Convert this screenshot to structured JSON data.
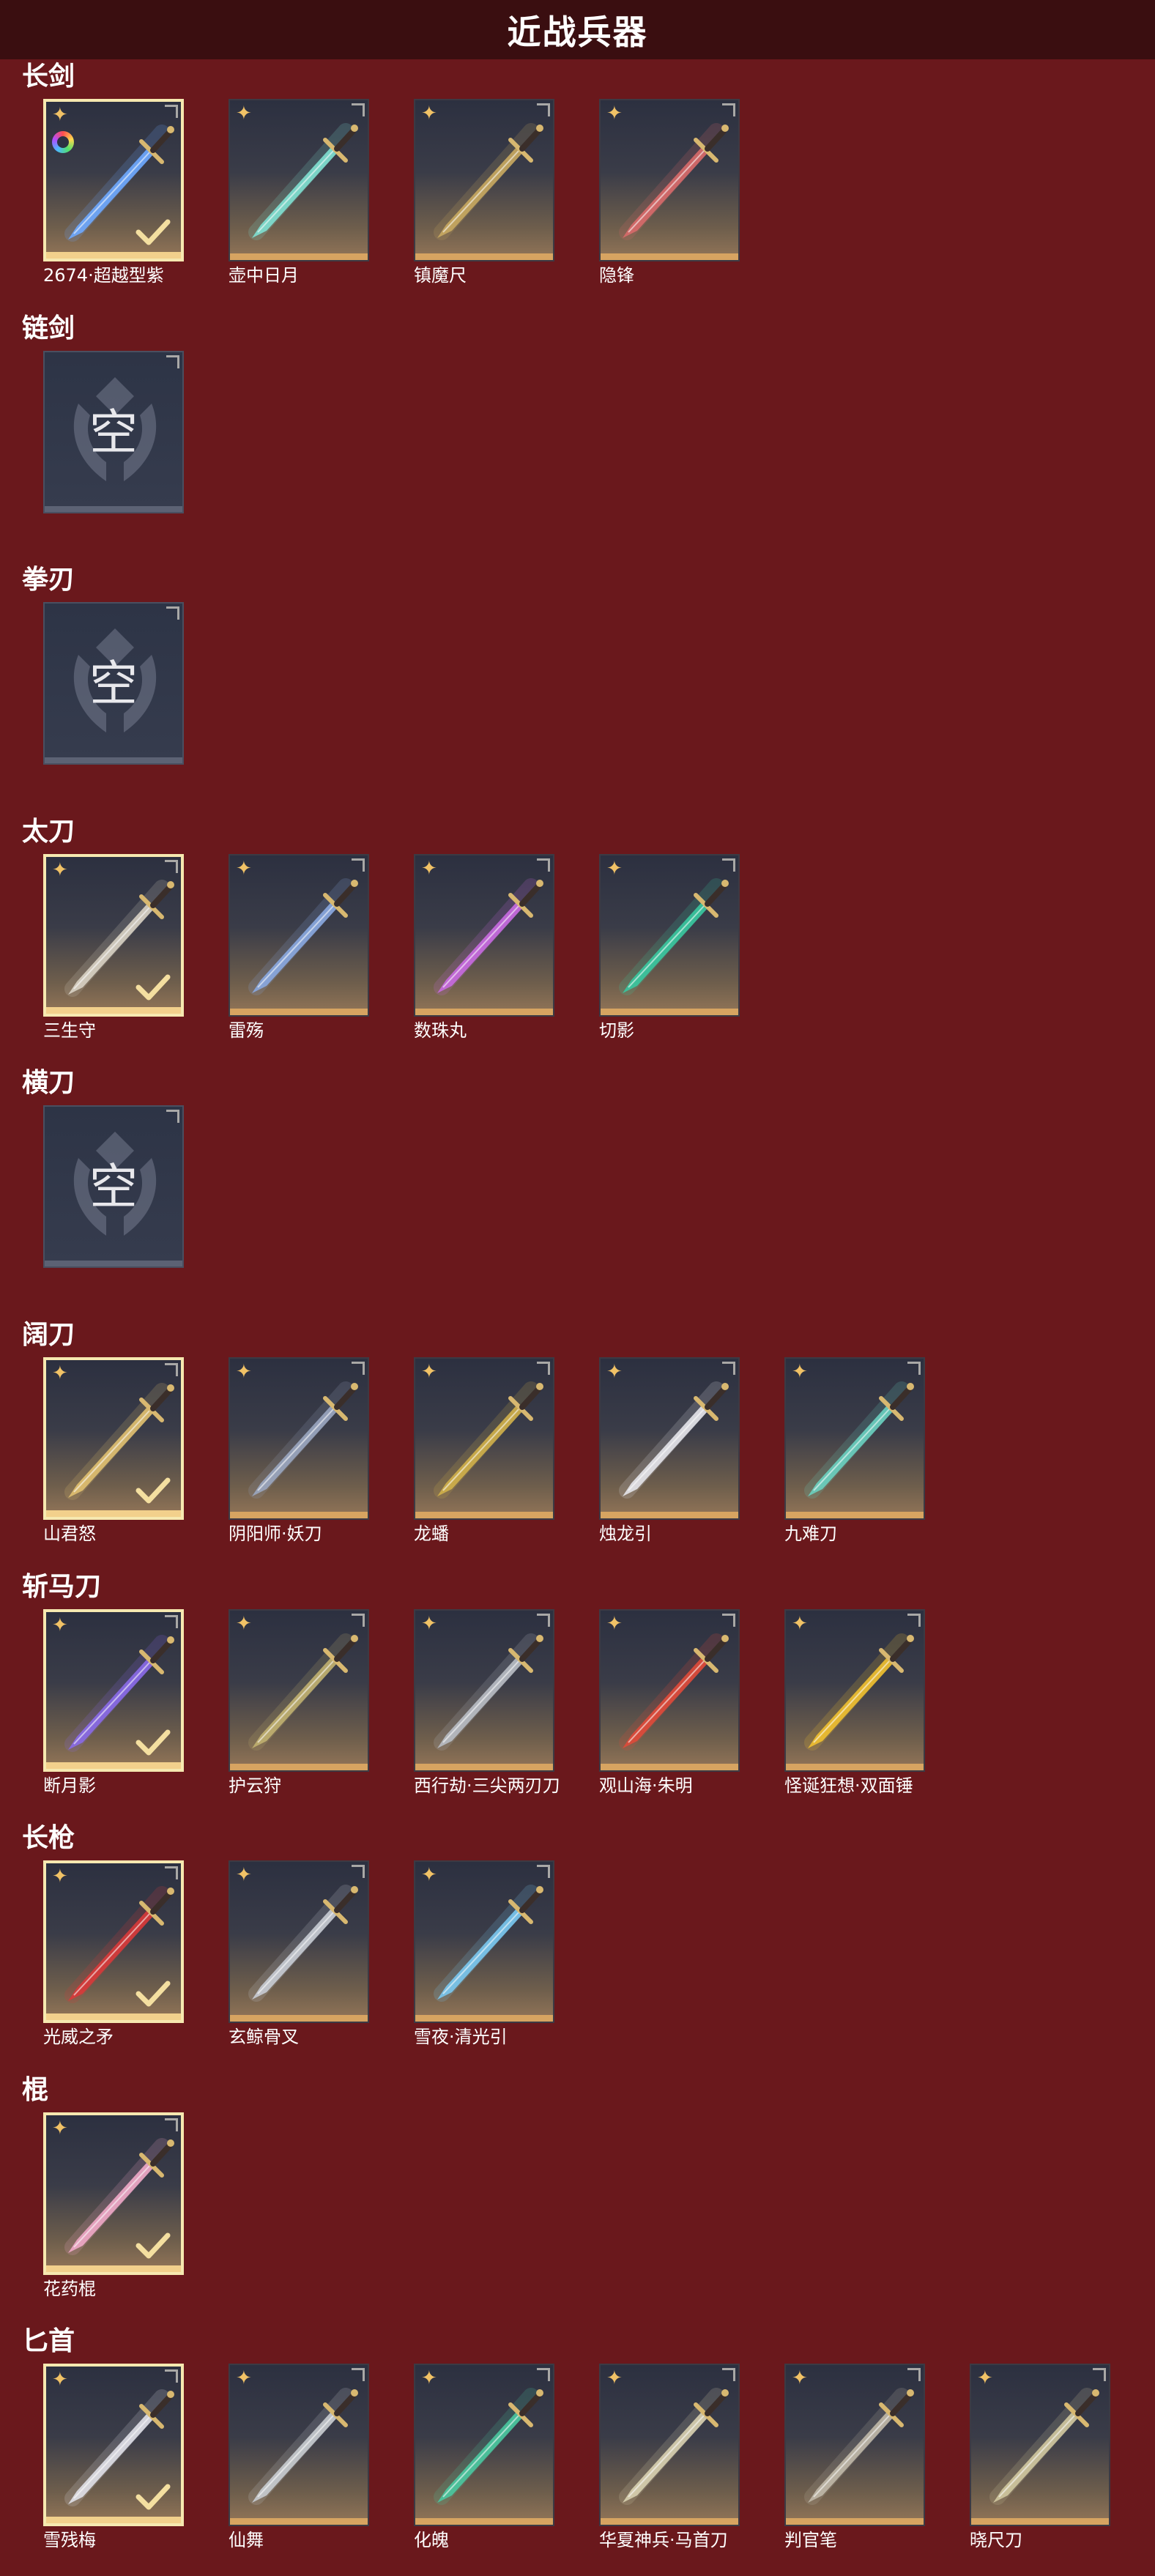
{
  "title": "近战兵器",
  "empty_text": "空",
  "colors": {
    "background": "#6a181c",
    "header": "#3a0e10",
    "tile_frame": "#d7a461",
    "equipped_border": "#f6e8b0",
    "star": "#f1c266"
  },
  "icons": {
    "star": "star-icon",
    "check": "check-icon",
    "rainbow": "rainbow-ring-icon",
    "empty": "empty-slot-emblem-icon"
  },
  "sections": [
    {
      "name": "长剑",
      "items": [
        {
          "label": "2674·超越型紫",
          "equipped": true,
          "color": "#6ea8ff",
          "rainbow": true
        },
        {
          "label": "壶中日月",
          "equipped": false,
          "color": "#7fe0d2"
        },
        {
          "label": "镇魔尺",
          "equipped": false,
          "color": "#c8a860"
        },
        {
          "label": "隐锋",
          "equipped": false,
          "color": "#d86a6a"
        }
      ]
    },
    {
      "name": "链剑",
      "items": []
    },
    {
      "name": "拳刃",
      "items": []
    },
    {
      "name": "太刀",
      "items": [
        {
          "label": "三生守",
          "equipped": true,
          "color": "#d8d2c4"
        },
        {
          "label": "雷殇",
          "equipped": false,
          "color": "#8aa8e0"
        },
        {
          "label": "数珠丸",
          "equipped": false,
          "color": "#c86ae0"
        },
        {
          "label": "切影",
          "equipped": false,
          "color": "#3ac8a0"
        }
      ]
    },
    {
      "name": "横刀",
      "items": []
    },
    {
      "name": "阔刀",
      "items": [
        {
          "label": "山君怒",
          "equipped": true,
          "color": "#e0c070"
        },
        {
          "label": "阴阳师·妖刀",
          "equipped": false,
          "color": "#9aa6c0"
        },
        {
          "label": "龙蟠",
          "equipped": false,
          "color": "#d0b04a"
        },
        {
          "label": "烛龙引",
          "equipped": false,
          "color": "#e4e4ea"
        },
        {
          "label": "九难刀",
          "equipped": false,
          "color": "#6ad0c0"
        }
      ]
    },
    {
      "name": "斩马刀",
      "items": [
        {
          "label": "断月影",
          "equipped": true,
          "color": "#8a6ae8"
        },
        {
          "label": "护云狩",
          "equipped": false,
          "color": "#c0b070"
        },
        {
          "label": "西行劫·三尖两刃刀",
          "equipped": false,
          "color": "#b8bcc4"
        },
        {
          "label": "观山海·朱明",
          "equipped": false,
          "color": "#e04a3a"
        },
        {
          "label": "怪诞狂想·双面锤",
          "equipped": false,
          "color": "#f0c030"
        }
      ]
    },
    {
      "name": "长枪",
      "items": [
        {
          "label": "光威之矛",
          "equipped": true,
          "color": "#d83a3a"
        },
        {
          "label": "玄鲸骨叉",
          "equipped": false,
          "color": "#c8ccd4"
        },
        {
          "label": "雪夜·清光引",
          "equipped": false,
          "color": "#7ac8f0"
        }
      ]
    },
    {
      "name": "棍",
      "items": [
        {
          "label": "花药棍",
          "equipped": true,
          "color": "#f0a8c8"
        }
      ]
    },
    {
      "name": "匕首",
      "items": [
        {
          "label": "雪残梅",
          "equipped": true,
          "color": "#e0e0e8"
        },
        {
          "label": "仙舞",
          "equipped": false,
          "color": "#c8ccd0"
        },
        {
          "label": "化魄",
          "equipped": false,
          "color": "#4ac8a0"
        },
        {
          "label": "华夏神兵·马首刀",
          "equipped": false,
          "color": "#d8d0b0"
        },
        {
          "label": "判官笔",
          "equipped": false,
          "color": "#c0b8a8"
        },
        {
          "label": "晓尺刀",
          "equipped": false,
          "color": "#d0c8a0"
        }
      ]
    }
  ]
}
